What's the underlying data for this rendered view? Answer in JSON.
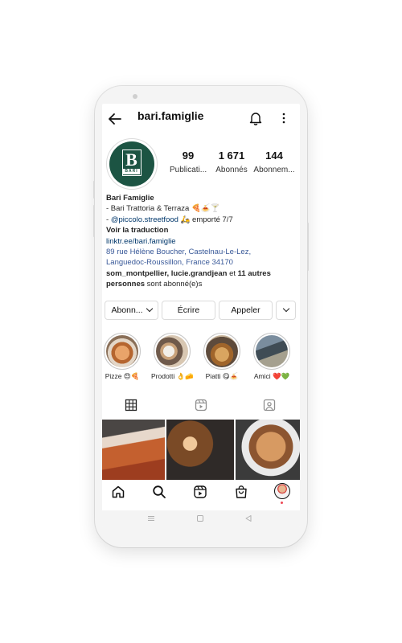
{
  "header": {
    "title": "bari.famiglie",
    "back_icon": "arrow-left-icon",
    "bell_icon": "bell-icon",
    "menu_icon": "more-vertical-icon"
  },
  "profile": {
    "logo_letter": "B",
    "logo_sub": "BARI",
    "stats": [
      {
        "value": "99",
        "label": "Publicati..."
      },
      {
        "value": "1 671",
        "label": "Abonnés"
      },
      {
        "value": "144",
        "label": "Abonnem..."
      }
    ]
  },
  "bio": {
    "name": "Bari Famiglie",
    "line1": "- Bari Trattoria & Terraza 🍕🍝🍸",
    "line2_prefix": "- ",
    "line2_handle": "@piccolo.streetfood",
    "line2_suffix": " 🛵 emporté 7/7",
    "translate": "Voir la traduction",
    "link": "linktr.ee/bari.famiglie",
    "address1": "89 rue Hélène Boucher, Castelnau-Le-Lez,",
    "address2": "Languedoc-Roussillon, France 34170",
    "followed_by_names": "som_montpellier, lucie.grandjean",
    "followed_by_and": " et ",
    "followed_by_count": "11 autres",
    "followed_by_persons": "personnes",
    "followed_by_suffix": " sont abonné(e)s"
  },
  "actions": {
    "follow": "Abonn...",
    "message": "Écrire",
    "call": "Appeler"
  },
  "highlights": [
    {
      "label": "Pizze 😍🍕"
    },
    {
      "label": "Prodotti 👌🧀"
    },
    {
      "label": "Piatti 😋🍝"
    },
    {
      "label": "Amici ❤️💚"
    }
  ],
  "tabs": [
    "grid-icon",
    "reels-icon",
    "tagged-icon"
  ],
  "bottom_nav": [
    "home-icon",
    "search-icon",
    "reels-icon",
    "shop-icon",
    "profile-avatar"
  ],
  "system_nav": [
    "recents-icon",
    "home-button-icon",
    "back-triangle-icon"
  ],
  "colors": {
    "brand_green": "#1c5443",
    "link_blue": "#00376b",
    "address_blue": "#385898"
  }
}
